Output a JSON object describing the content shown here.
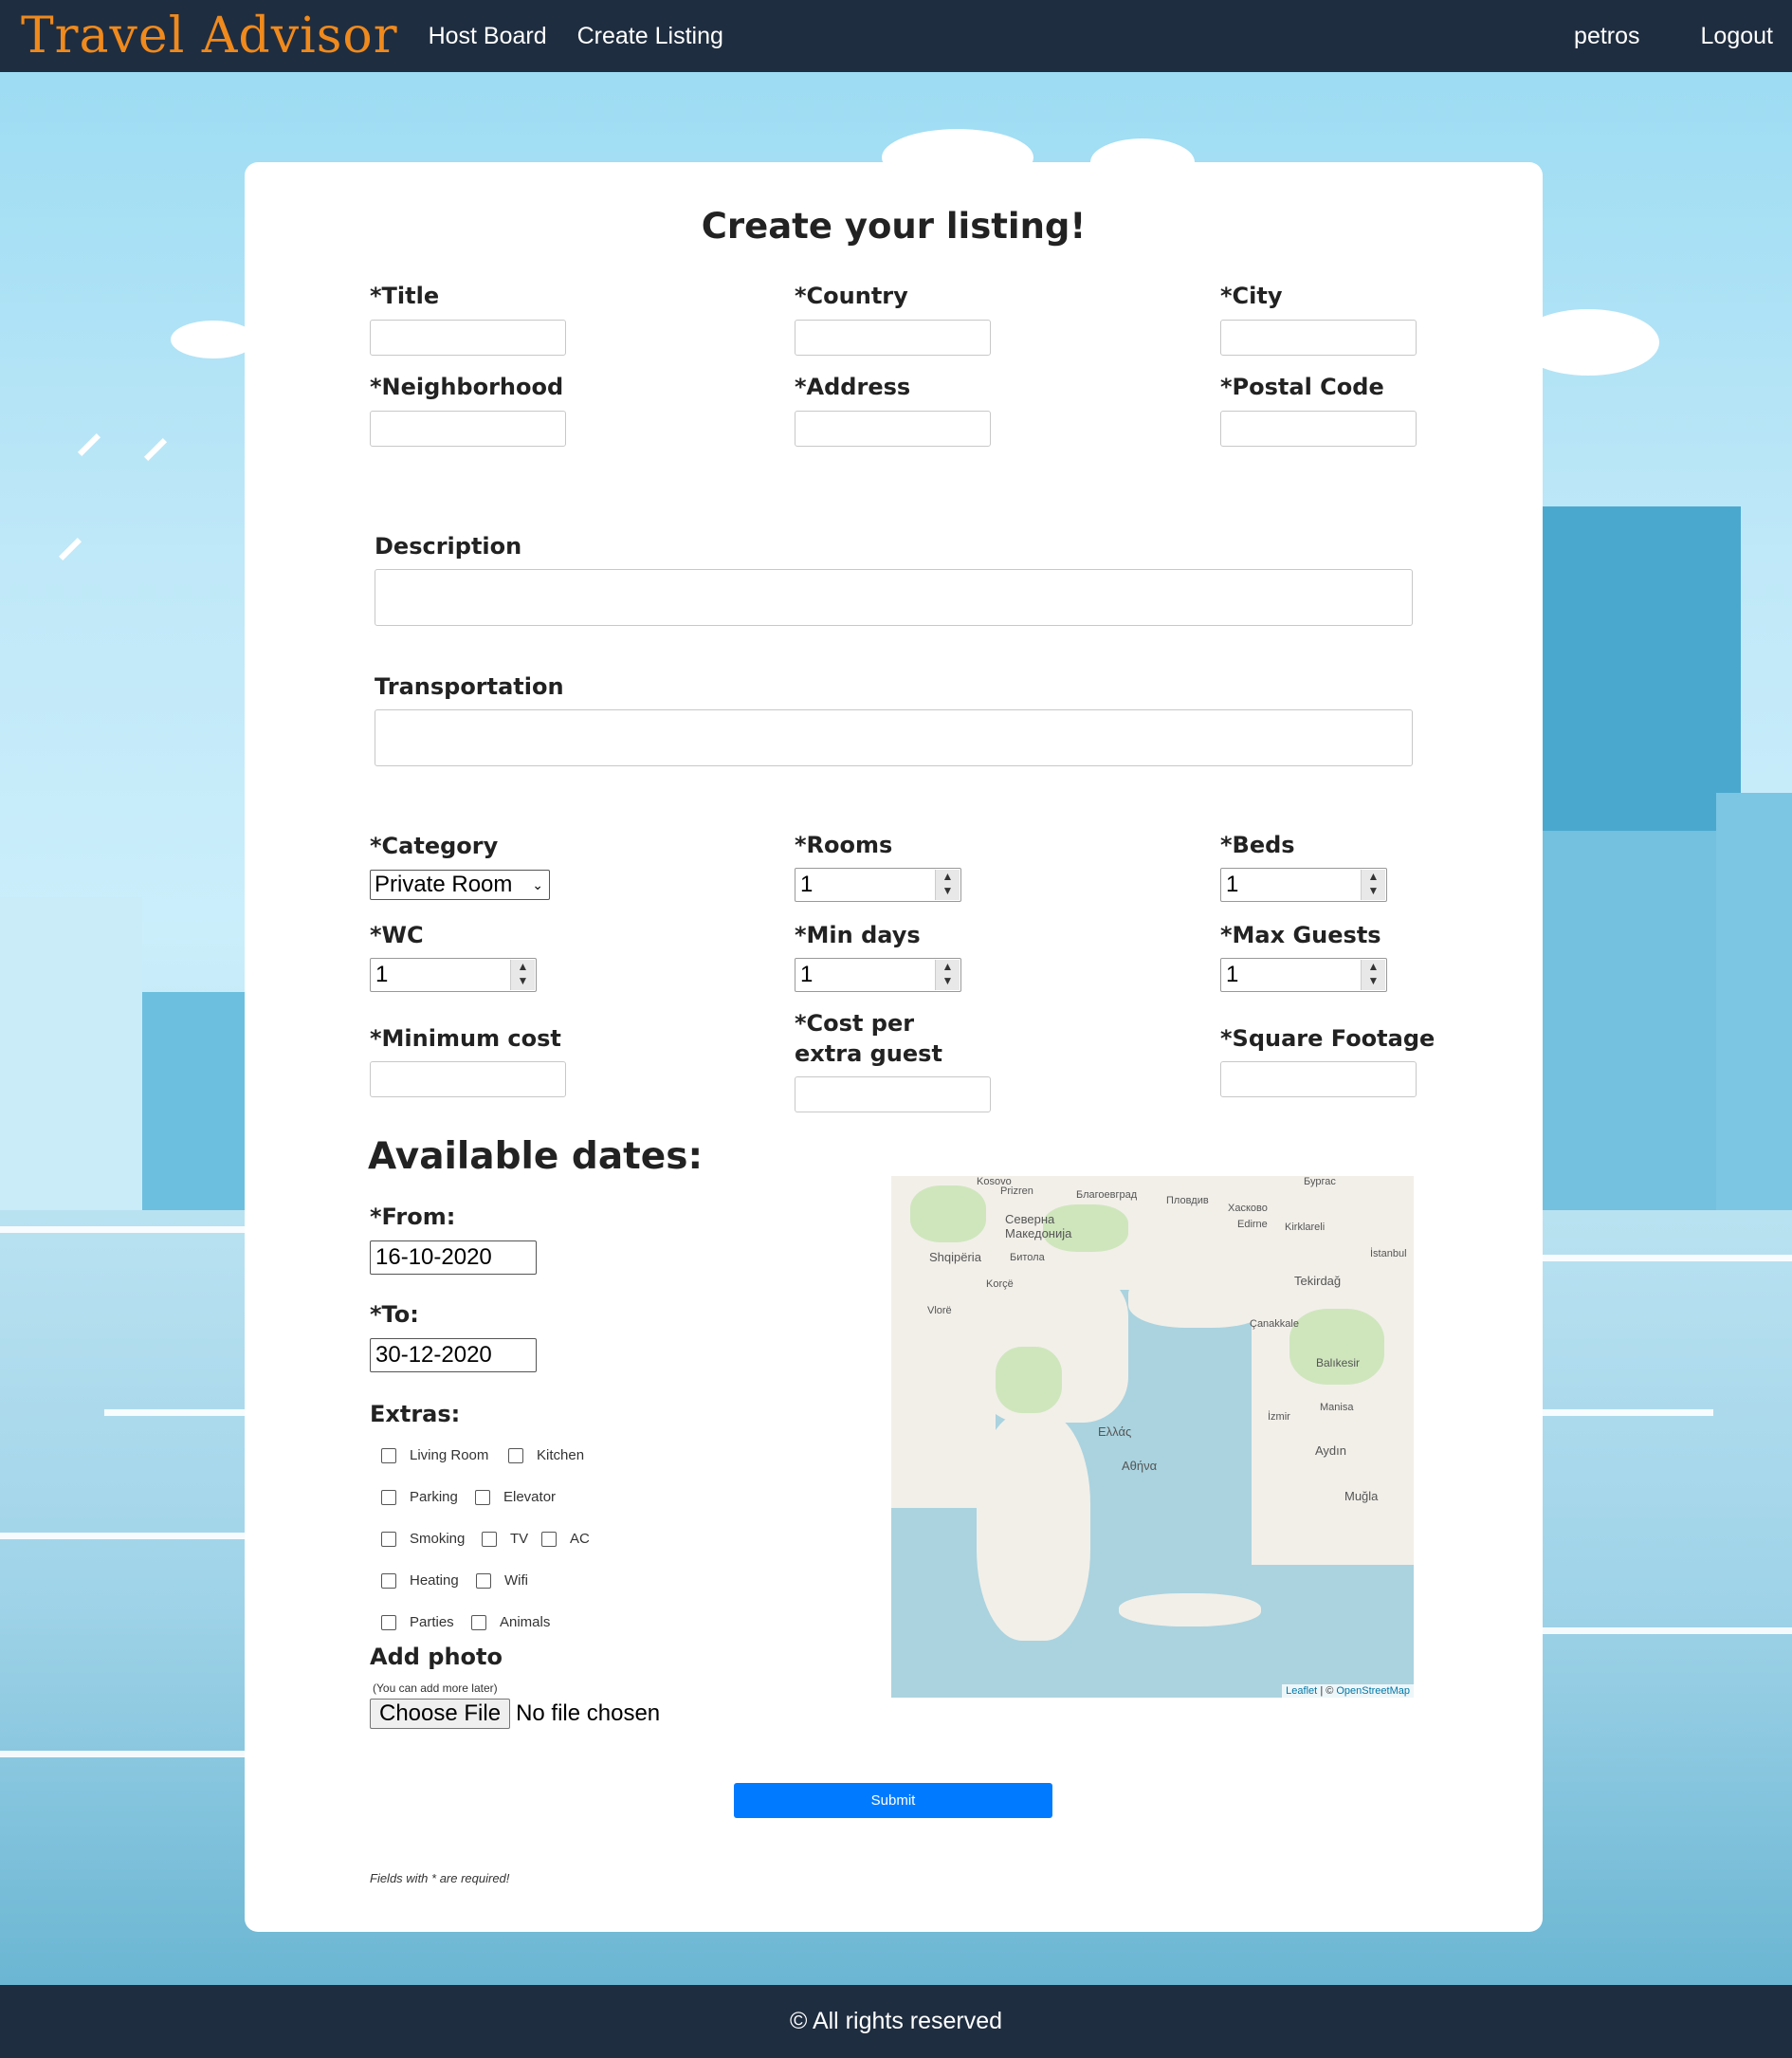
{
  "nav": {
    "brand": "Travel Advisor",
    "links": [
      "Host Board",
      "Create Listing"
    ],
    "user": "petros",
    "logout": "Logout"
  },
  "form": {
    "title": "Create your listing!",
    "fields": {
      "title": "*Title",
      "country": "*Country",
      "city": "*City",
      "neighborhood": "*Neighborhood",
      "address": "*Address",
      "postal_code": "*Postal Code",
      "description": "Description",
      "transportation": "Transportation",
      "category": "*Category",
      "rooms": "*Rooms",
      "beds": "*Beds",
      "wc": "*WC",
      "min_days": "*Min days",
      "max_guests": "*Max Guests",
      "minimum_cost": "*Minimum cost",
      "cost_extra_guest": "*Cost per extra guest",
      "square_footage": "*Square Footage"
    },
    "values": {
      "category": "Private Room",
      "rooms": "1",
      "beds": "1",
      "wc": "1",
      "min_days": "1",
      "max_guests": "1"
    },
    "dates": {
      "heading": "Available dates:",
      "from_label": "*From:",
      "from": "16-10-2020",
      "to_label": "*To:",
      "to": "30-12-2020"
    },
    "extras": {
      "label": "Extras:",
      "items": [
        "Living Room",
        "Kitchen",
        "Parking",
        "Elevator",
        "Smoking",
        "TV",
        "AC",
        "Heating",
        "Wifi",
        "Parties",
        "Animals"
      ]
    },
    "photo": {
      "label": "Add photo",
      "hint": "(You can add more later)",
      "button": "Choose File",
      "status": "No file chosen"
    },
    "submit": "Submit",
    "note": "Fields with * are required!"
  },
  "map": {
    "labels": [
      "Kosovo",
      "Prizren",
      "Благоевград",
      "Пловдив",
      "Хасково",
      "Бургас",
      "Северна Македонија",
      "Shqipëria",
      "Битола",
      "Edirne",
      "Kirklareli",
      "İstanbul",
      "Korçë",
      "Tekirdağ",
      "Vlorë",
      "Çanakkale",
      "Balıkesir",
      "Ελλάς",
      "Αθήνα",
      "İzmir",
      "Manisa",
      "Aydın",
      "Muğla"
    ],
    "attribution_leaflet": "Leaflet",
    "attribution_sep": " | © ",
    "attribution_osm": "OpenStreetMap"
  },
  "footer": "© All rights reserved"
}
